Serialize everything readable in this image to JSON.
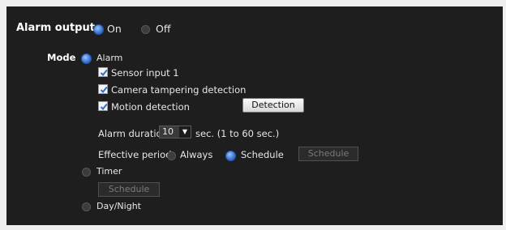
{
  "alarm_output": {
    "label": "Alarm output",
    "on_label": "On",
    "off_label": "Off",
    "selected": "On"
  },
  "mode": {
    "label": "Mode",
    "alarm_label": "Alarm",
    "sensor_input_label": "Sensor input 1",
    "camera_tampering_label": "Camera tampering detection",
    "motion_detection_label": "Motion detection",
    "detection_button": "Detection",
    "alarm_duration_label": "Alarm duration",
    "alarm_duration_value": "10",
    "alarm_duration_hint": "sec. (1 to 60 sec.)",
    "effective_period_label": "Effective period",
    "always_label": "Always",
    "schedule_label": "Schedule",
    "schedule_button": "Schedule",
    "effective_period_selected": "Schedule",
    "timer_label": "Timer",
    "timer_schedule_button": "Schedule",
    "day_night_label": "Day/Night",
    "selected": "Alarm"
  },
  "colors": {
    "panel_background": "#1e1e1e",
    "radio_selected": "#3f7bd6",
    "page_background": "#f0f0f0"
  }
}
